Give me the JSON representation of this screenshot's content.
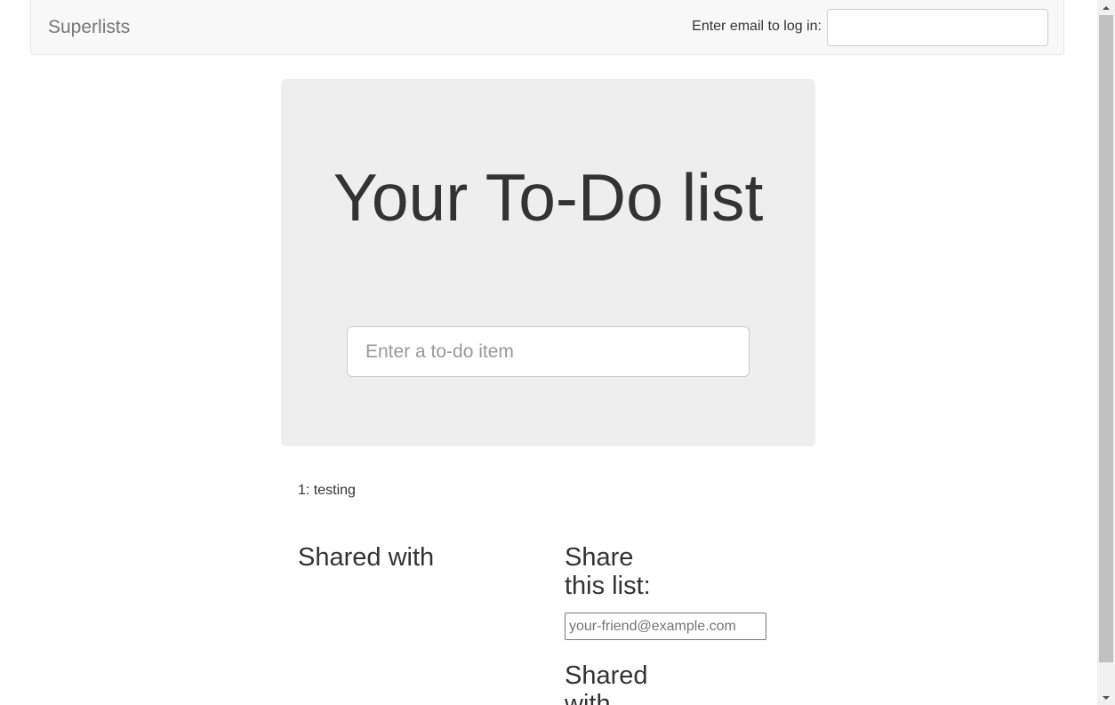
{
  "navbar": {
    "brand": "Superlists",
    "login_label": "Enter email to log in:",
    "login_input_value": ""
  },
  "jumbotron": {
    "title": "Your To-Do list",
    "item_input_placeholder": "Enter a to-do item"
  },
  "list_table": {
    "rows": [
      "1: testing"
    ]
  },
  "shared": {
    "shared_with_heading": "Shared with",
    "share_heading": "Share this list:",
    "share_input_placeholder": "your-friend@example.com",
    "shared_with_heading_2": "Shared with"
  },
  "colors": {
    "navbar_bg": "#f8f8f8",
    "jumbotron_bg": "#eeeeee",
    "text": "#333333",
    "brand": "#777777"
  }
}
